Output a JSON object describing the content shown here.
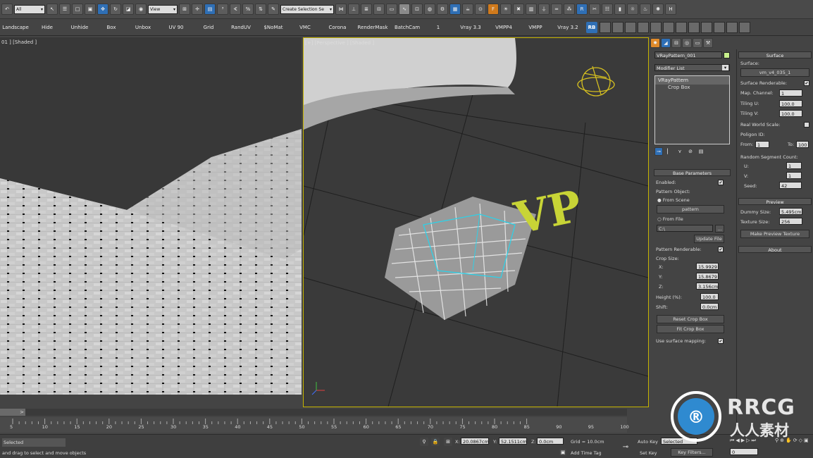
{
  "toolbar": {
    "filter_select": "All",
    "view_select": "View",
    "selection_set": "Create Selection Se"
  },
  "macros": {
    "items": [
      "Landscape",
      "Hide",
      "Unhide",
      "Box",
      "Unbox",
      "UV 90",
      "Grid",
      "RandUV",
      "$NoMat",
      "VMC",
      "Corona",
      "RenderMask",
      "BatchCam",
      "1",
      "Vray 3.3",
      "VMPP4",
      "VMPP",
      "Vray 3.2"
    ],
    "rb_label": "RB"
  },
  "viewports": {
    "left_label": "01 ] [Shaded ]",
    "right_label": "[+] [Perspective ] [Shaded ]",
    "logo_text": "VP"
  },
  "command_panel": {
    "object_name": "VRayPattern_001",
    "object_color": "#c8f08c",
    "modifier_list": "Modifier List",
    "stack": [
      "VRayPattern",
      "Crop Box"
    ],
    "base_params": {
      "header": "Base Parameters",
      "enabled_label": "Enabled:",
      "pattern_object_label": "Pattern Object:",
      "from_scene": "From Scene",
      "pattern_button": "pattern",
      "from_file": "From File",
      "file_path": "C:\\",
      "browse_label": "...",
      "update_file": "Update File",
      "pattern_renderable": "Pattern Renderable:",
      "crop_size": "Crop Size:",
      "x_label": "X:",
      "x_value": "15.9929",
      "y_label": "Y:",
      "y_value": "15.8679",
      "z_label": "Z:",
      "z_value": "3.156cm",
      "height_label": "Height (%):",
      "height_value": "100.0",
      "shift_label": "Shift:",
      "shift_value": "0.0cm",
      "reset_crop": "Reset Crop Box",
      "fit_crop": "Fit Crop Box",
      "use_surface": "Use surface mapping:"
    }
  },
  "surface_panel": {
    "header": "Surface",
    "surface_label": "Surface:",
    "surface_button": "vm_v4_035_1",
    "surface_renderable": "Surface Renderable:",
    "map_channel_label": "Map. Channel:",
    "map_channel": "1",
    "tiling_u_label": "Tiling U:",
    "tiling_u": "100.0",
    "tiling_v_label": "Tiling V:",
    "tiling_v": "100.0",
    "real_world": "Real World Scale:",
    "polygon_id": "Poligon ID:",
    "from_label": "From:",
    "from_value": "1",
    "to_label": "To:",
    "to_value": "100",
    "random_segment": "Random Segment Count:",
    "u_label": "U:",
    "u_value": "1",
    "v_label": "V:",
    "v_value": "1",
    "seed_label": "Seed:",
    "seed_value": "42",
    "preview_header": "Preview",
    "dummy_label": "Dummy Size:",
    "dummy_value": "5.495cm",
    "texture_label": "Texture Size:",
    "texture_value": "256",
    "make_preview": "Make Preview Texture",
    "about_header": "About"
  },
  "timeline": {
    "slider_label": ">",
    "ticks": [
      "5",
      "10",
      "15",
      "20",
      "25",
      "30",
      "35",
      "40",
      "45",
      "50",
      "55",
      "60",
      "65",
      "70",
      "75",
      "80",
      "85",
      "90",
      "95",
      "100"
    ]
  },
  "status": {
    "selection": "Selected",
    "prompt": "and drag to select and move objects",
    "x_label": "X:",
    "x_value": "20.0867cm",
    "y_label": "Y:",
    "y_value": "52.1511cm",
    "z_label": "Z:",
    "z_value": "0.0cm",
    "grid": "Grid = 10.0cm",
    "add_time_tag": "Add Time Tag",
    "auto_key": "Auto Key",
    "set_key": "Set Key",
    "key_mode": "Selected",
    "key_filters": "Key Filters...",
    "frame": "0"
  },
  "watermark": {
    "text": "RRCG",
    "subtext": "人人素材"
  }
}
